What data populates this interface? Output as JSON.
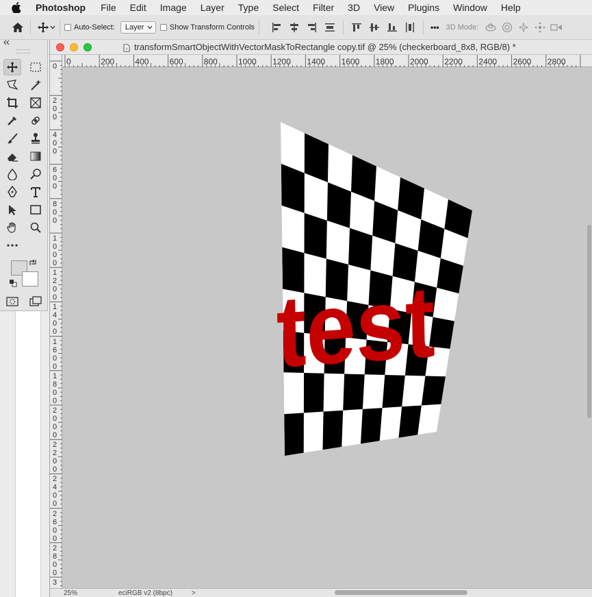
{
  "menubar": {
    "app_name": "Photoshop",
    "items": [
      "File",
      "Edit",
      "Image",
      "Layer",
      "Type",
      "Select",
      "Filter",
      "3D",
      "View",
      "Plugins",
      "Window",
      "Help"
    ]
  },
  "options_bar": {
    "auto_select_label": "Auto-Select:",
    "auto_select_checked": false,
    "target_select_value": "Layer",
    "show_transform_label": "Show Transform Controls",
    "show_transform_checked": false,
    "more_label": "•••",
    "mode_3d_label": "3D Mode:"
  },
  "tools": {
    "active": "move-tool",
    "foreground_color": "#d9d9d7",
    "background_color": "#ffffff"
  },
  "document": {
    "title": "transformSmartObjectWithVectorMaskToRectangle copy.tif @ 25% (checkerboard_8x8, RGB/8) *",
    "ruler_top_labels": [
      "0",
      "200",
      "400",
      "600",
      "800",
      "1000",
      "1200",
      "1400",
      "1600",
      "1800",
      "2000",
      "2200",
      "2400",
      "2600",
      "2800"
    ],
    "ruler_left_labels": [
      "0",
      "200",
      "400",
      "600",
      "800",
      "1000",
      "1200",
      "1400",
      "1600",
      "1800",
      "2000",
      "2200",
      "2400",
      "2600",
      "2800",
      "3"
    ],
    "canvas": {
      "layer_text": "test",
      "text_color": "#c40000",
      "background": "#c8c8c8"
    }
  },
  "status": {
    "zoom": "25%",
    "doc_info": "eciRGB v2 (8bpc)",
    "chevron": ">"
  }
}
